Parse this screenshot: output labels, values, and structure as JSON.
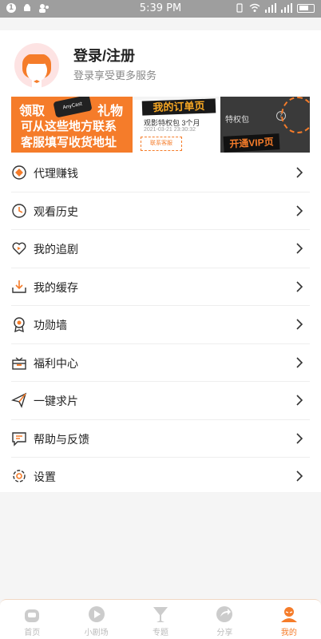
{
  "statusbar": {
    "time": "5:39 PM",
    "notif": "1"
  },
  "profile": {
    "title": "登录/注册",
    "subtitle": "登录享受更多服务"
  },
  "banner": {
    "b1": {
      "line1a": "领取",
      "line1b": "礼物",
      "line2": "可从这些地方联系",
      "line3": "客服填写收货地址",
      "device": "AnyCast"
    },
    "b2": {
      "heading": "我的订单页",
      "item": "观影特权包 3个月",
      "date": "2021-03-21 23:30:32",
      "button": "联系客服"
    },
    "b3": {
      "item": "特权包",
      "vip": "开通VIP页"
    }
  },
  "menu": [
    {
      "label": "代理赚钱",
      "icon": "agent-money-icon"
    },
    {
      "label": "观看历史",
      "icon": "history-clock-icon"
    },
    {
      "label": "我的追剧",
      "icon": "follow-heart-icon"
    },
    {
      "label": "我的缓存",
      "icon": "download-cache-icon"
    },
    {
      "label": "功勋墙",
      "icon": "medal-icon"
    },
    {
      "label": "福利中心",
      "icon": "gift-icon"
    },
    {
      "label": "一键求片",
      "icon": "paper-plane-icon"
    },
    {
      "label": "帮助与反馈",
      "icon": "help-feedback-icon"
    },
    {
      "label": "设置",
      "icon": "settings-gear-icon"
    }
  ],
  "tabs": [
    {
      "label": "首页",
      "icon": "home-tv-icon"
    },
    {
      "label": "小剧场",
      "icon": "play-circle-icon"
    },
    {
      "label": "专题",
      "icon": "topic-cup-icon"
    },
    {
      "label": "分享",
      "icon": "share-icon"
    },
    {
      "label": "我的",
      "icon": "profile-icon",
      "active": true
    }
  ],
  "colors": {
    "accent": "#f57c2a",
    "statusbar": "#9e9e9e"
  }
}
